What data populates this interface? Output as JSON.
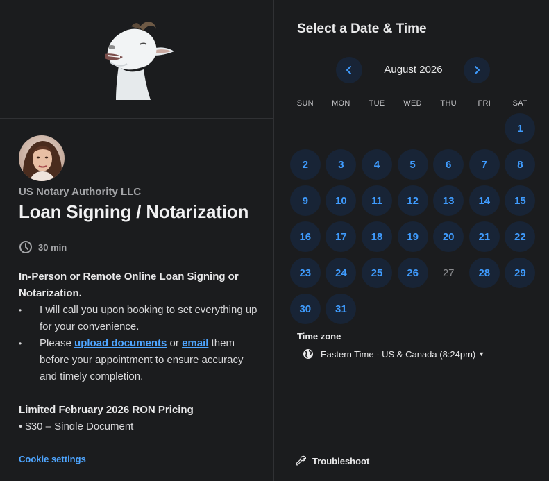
{
  "left_panel": {
    "organizer": "US Notary Authority LLC",
    "event_title": "Loan Signing / Notarization",
    "duration": "30 min",
    "description": {
      "heading": "In-Person or Remote Online Loan Signing or Notarization.",
      "bullet_1": "I will call you upon booking to set everything up for your convenience.",
      "bullet_2_prefix": "Please ",
      "bullet_2_link_1": "upload documents",
      "bullet_2_middle": " or ",
      "bullet_2_link_2": "email",
      "bullet_2_suffix": " them before your appointment to ensure accuracy and timely completion.",
      "pricing_heading": "Limited February 2026 RON Pricing",
      "pricing_item_1": "• $30 – Single Document"
    },
    "cookie_settings": "Cookie settings"
  },
  "right_panel": {
    "title": "Select a Date & Time",
    "month": "August 2026",
    "weekdays": [
      "SUN",
      "MON",
      "TUE",
      "WED",
      "THU",
      "FRI",
      "SAT"
    ],
    "first_weekday_index": 6,
    "days_in_month": 31,
    "unavailable_days": [
      27
    ],
    "timezone_label": "Time zone",
    "timezone_value": "Eastern Time - US & Canada (8:24pm)",
    "troubleshoot": "Troubleshoot"
  },
  "icons": {
    "clock": "clock-icon",
    "globe": "globe-icon",
    "wrench": "wrench-icon",
    "prev": "chevron-left-icon",
    "next": "chevron-right-icon",
    "caret": "caret-down-icon"
  },
  "colors": {
    "background": "#1b1c1e",
    "accent": "#3f9bfd",
    "link": "#4ea5ff",
    "day_bg": "#182436"
  }
}
